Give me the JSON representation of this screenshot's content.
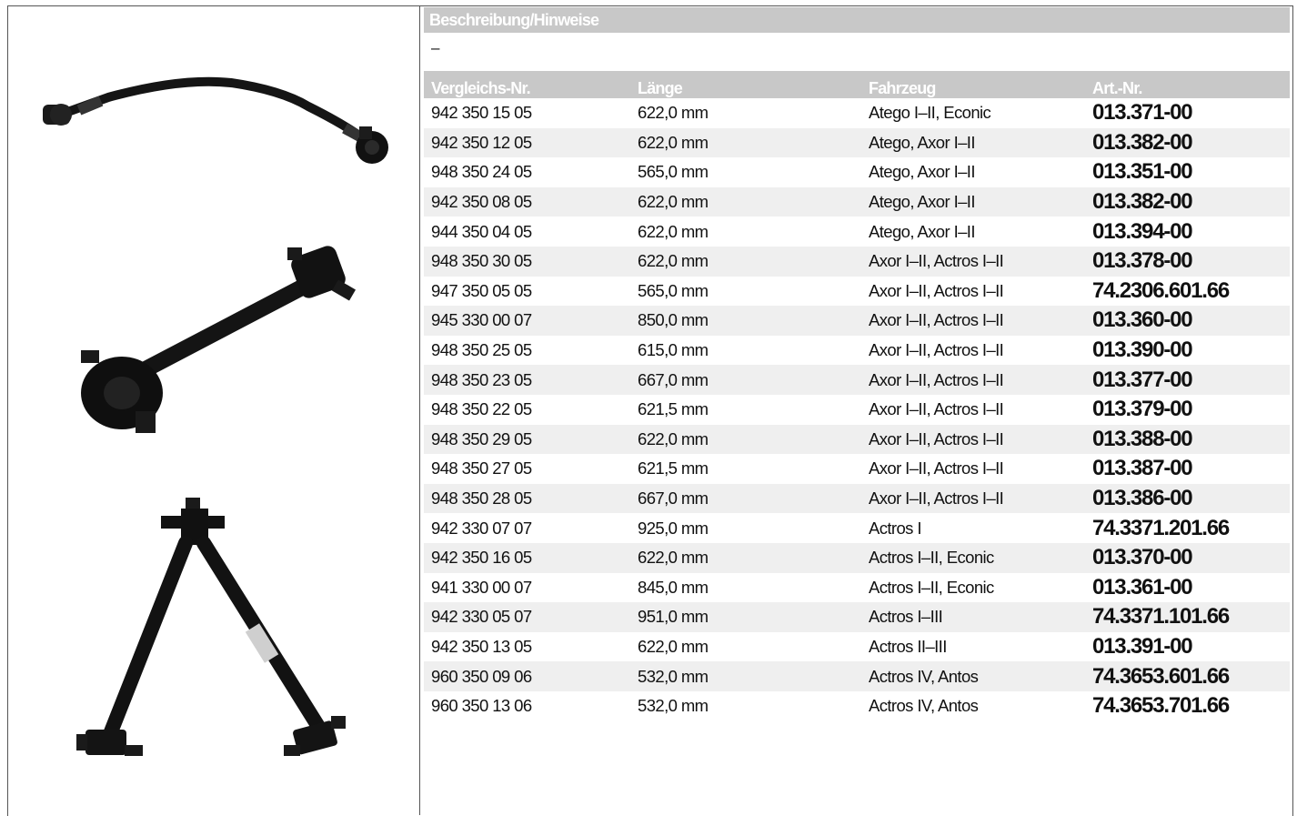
{
  "description": {
    "header": "Beschreibung/Hinweise",
    "text": "–"
  },
  "table": {
    "headers": [
      "Vergleichs-Nr.",
      "Länge",
      "Fahrzeug",
      "Art.-Nr."
    ],
    "rows": [
      [
        "942 350 15 05",
        "622,0 mm",
        "Atego I–II, Econic",
        "013.371-00"
      ],
      [
        "942 350 12 05",
        "622,0 mm",
        "Atego, Axor I–II",
        "013.382-00"
      ],
      [
        "948 350 24 05",
        "565,0 mm",
        "Atego, Axor I–II",
        "013.351-00"
      ],
      [
        "942 350 08 05",
        "622,0 mm",
        "Atego, Axor I–II",
        "013.382-00"
      ],
      [
        "944 350 04 05",
        "622,0 mm",
        "Atego, Axor I–II",
        "013.394-00"
      ],
      [
        "948 350 30 05",
        "622,0 mm",
        "Axor I–II, Actros I–II",
        "013.378-00"
      ],
      [
        "947 350 05 05",
        "565,0 mm",
        "Axor I–II, Actros I–II",
        "74.2306.601.66"
      ],
      [
        "945 330 00 07",
        "850,0 mm",
        "Axor I–II, Actros I–II",
        "013.360-00"
      ],
      [
        "948 350 25 05",
        "615,0 mm",
        "Axor I–II, Actros I–II",
        "013.390-00"
      ],
      [
        "948 350 23 05",
        "667,0 mm",
        "Axor I–II, Actros I–II",
        "013.377-00"
      ],
      [
        "948 350 22 05",
        "621,5 mm",
        "Axor I–II, Actros I–II",
        "013.379-00"
      ],
      [
        "948 350 29 05",
        "622,0 mm",
        "Axor I–II, Actros I–II",
        "013.388-00"
      ],
      [
        "948 350 27 05",
        "621,5 mm",
        "Axor I–II, Actros I–II",
        "013.387-00"
      ],
      [
        "948 350 28 05",
        "667,0 mm",
        "Axor I–II, Actros I–II",
        "013.386-00"
      ],
      [
        "942 330 07 07",
        "925,0 mm",
        "Actros I",
        "74.3371.201.66"
      ],
      [
        "942 350 16 05",
        "622,0 mm",
        "Actros I–II, Econic",
        "013.370-00"
      ],
      [
        "941 330 00 07",
        "845,0 mm",
        "Actros I–II, Econic",
        "013.361-00"
      ],
      [
        "942 330 05 07",
        "951,0 mm",
        "Actros I–III",
        "74.3371.101.66"
      ],
      [
        "942 350 13 05",
        "622,0 mm",
        "Actros II–III",
        "013.391-00"
      ],
      [
        "960 350 09 06",
        "532,0 mm",
        "Actros IV, Antos",
        "74.3653.601.66"
      ],
      [
        "960 350 13 06",
        "532,0 mm",
        "Actros IV, Antos",
        "74.3653.701.66"
      ]
    ]
  }
}
